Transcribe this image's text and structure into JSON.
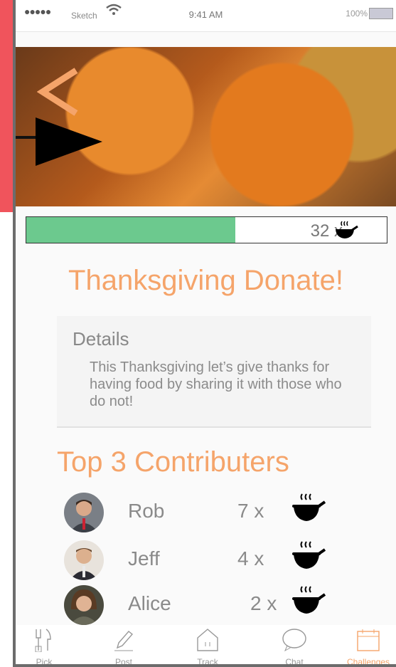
{
  "status_bar": {
    "signal": "●●●●●",
    "carrier": "Sketch",
    "time": "9:41 AM",
    "battery": "100%"
  },
  "progress": {
    "count": "32 x",
    "fill_fraction": 0.58,
    "icon": "pot-icon"
  },
  "title": "Thanksgiving Donate!",
  "details": {
    "heading": "Details",
    "body": "This Thanksgiving let’s give thanks for having food by sharing it with those who do not!"
  },
  "contributors": {
    "heading": "Top 3 Contributers",
    "rows": [
      {
        "name": "Rob",
        "qty": "7 x",
        "icon": "pot-icon"
      },
      {
        "name": "Jeff",
        "qty": "4 x",
        "icon": "pot-icon"
      },
      {
        "name": "Alice",
        "qty": "2 x",
        "icon": "pot-icon"
      }
    ]
  },
  "tabs": [
    {
      "label": "Pick",
      "icon": "utensils-icon"
    },
    {
      "label": "Post",
      "icon": "pencil-icon"
    },
    {
      "label": "Track",
      "icon": "house-icon"
    },
    {
      "label": "Chat",
      "icon": "chat-bubble-icon"
    },
    {
      "label": "Challenges",
      "icon": "calendar-icon",
      "active": true
    }
  ],
  "colors": {
    "accent": "#f5a46a",
    "progress": "#6cc98e",
    "background_red": "#f0545c"
  }
}
